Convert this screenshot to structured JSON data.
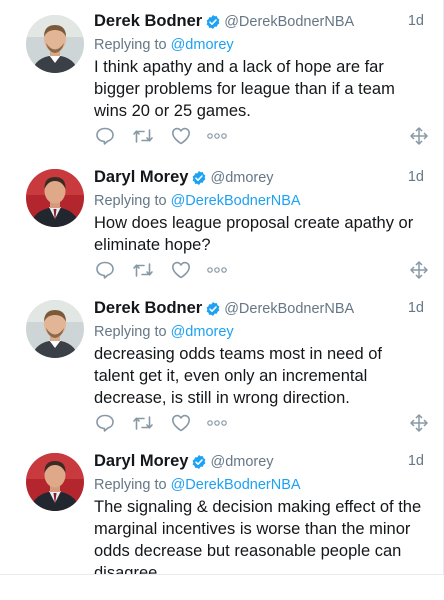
{
  "tweets": [
    {
      "name": "Derek Bodner",
      "handle": "@DerekBodnerNBA",
      "time": "1d",
      "replying_prefix": "Replying to ",
      "replying_to": "@dmorey",
      "text": "I think apathy and a lack of hope are far bigger problems for league than if a team wins 20 or 25 games.",
      "avatar": "derek"
    },
    {
      "name": "Daryl Morey",
      "handle": "@dmorey",
      "time": "1d",
      "replying_prefix": "Replying to ",
      "replying_to": "@DerekBodnerNBA",
      "text": "How does league proposal create apathy or eliminate hope?",
      "avatar": "daryl"
    },
    {
      "name": "Derek Bodner",
      "handle": "@DerekBodnerNBA",
      "time": "1d",
      "replying_prefix": "Replying to ",
      "replying_to": "@dmorey",
      "text": "decreasing odds teams most in need of talent get it, even only an incremental decrease, is still in wrong direction.",
      "avatar": "derek"
    },
    {
      "name": "Daryl Morey",
      "handle": "@dmorey",
      "time": "1d",
      "replying_prefix": "Replying to ",
      "replying_to": "@DerekBodnerNBA",
      "text": "The signaling & decision making effect of the marginal incentives is worse than the minor odds decrease but reasonable people can disagree",
      "avatar": "daryl"
    }
  ],
  "icons": {
    "reply": "reply-icon",
    "retweet": "retweet-icon",
    "like": "heart-icon",
    "more": "more-dots-icon",
    "move": "move-arrows-icon",
    "verified": "verified-badge-icon"
  },
  "colors": {
    "link": "#1da1f2",
    "secondary": "#657786",
    "icon": "#8899a6",
    "verified": "#1da1f2"
  }
}
